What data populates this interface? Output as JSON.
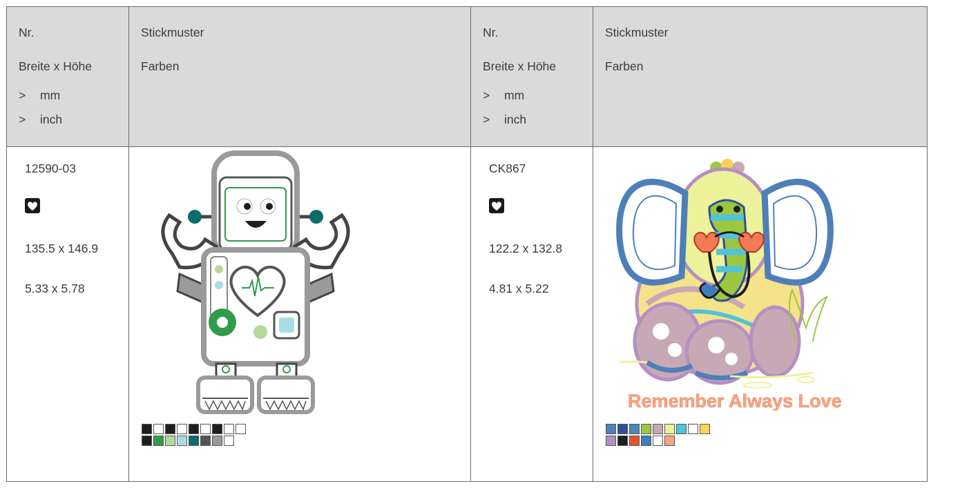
{
  "header": {
    "left": {
      "nr": "Nr.",
      "pattern": "Stickmuster",
      "size": "Breite x Höhe",
      "colors": "Farben",
      "unit_mm": "mm",
      "unit_inch": "inch",
      "marker": ">"
    },
    "right": {
      "nr": "Nr.",
      "pattern": "Stickmuster",
      "size": "Breite x Höhe",
      "colors": "Farben",
      "unit_mm": "mm",
      "unit_inch": "inch",
      "marker": ">"
    }
  },
  "rows": [
    {
      "left": {
        "nr": "12590-03",
        "size_mm": "135.5 x 146.9",
        "size_inch": "5.33 x 5.78",
        "icon": "heart-badge-icon",
        "design": "robot-embroidery",
        "palette_row1": [
          "#1e1e1e",
          "#ffffff",
          "#1e1e1e",
          "#ffffff",
          "#1e1e1e",
          "#ffffff",
          "#1e1e1e",
          "#ffffff",
          "#ffffff"
        ],
        "palette_row2": [
          "#1e1e1e",
          "#2f9c4a",
          "#b5d99c",
          "#a9dde4",
          "#0e6b6b",
          "#555555",
          "#9a9a9a",
          "#ffffff"
        ]
      },
      "right": {
        "nr": "CK867",
        "size_mm": "122.2 x 132.8",
        "size_inch": "4.81 x 5.22",
        "icon": "heart-badge-icon",
        "design": "elephant-embroidery",
        "caption": "Remember Always Love",
        "palette_row1": [
          "#4f7fb8",
          "#2e4f9b",
          "#4a86b8",
          "#9cc740",
          "#c6a9b5",
          "#eef29a",
          "#52c3d8",
          "#ffffff",
          "#ffd257"
        ],
        "palette_row2": [
          "#b58fc4",
          "#1e1e1e",
          "#e8532e",
          "#3f7dbf",
          "#ffffff",
          "#f5a582"
        ]
      }
    }
  ]
}
